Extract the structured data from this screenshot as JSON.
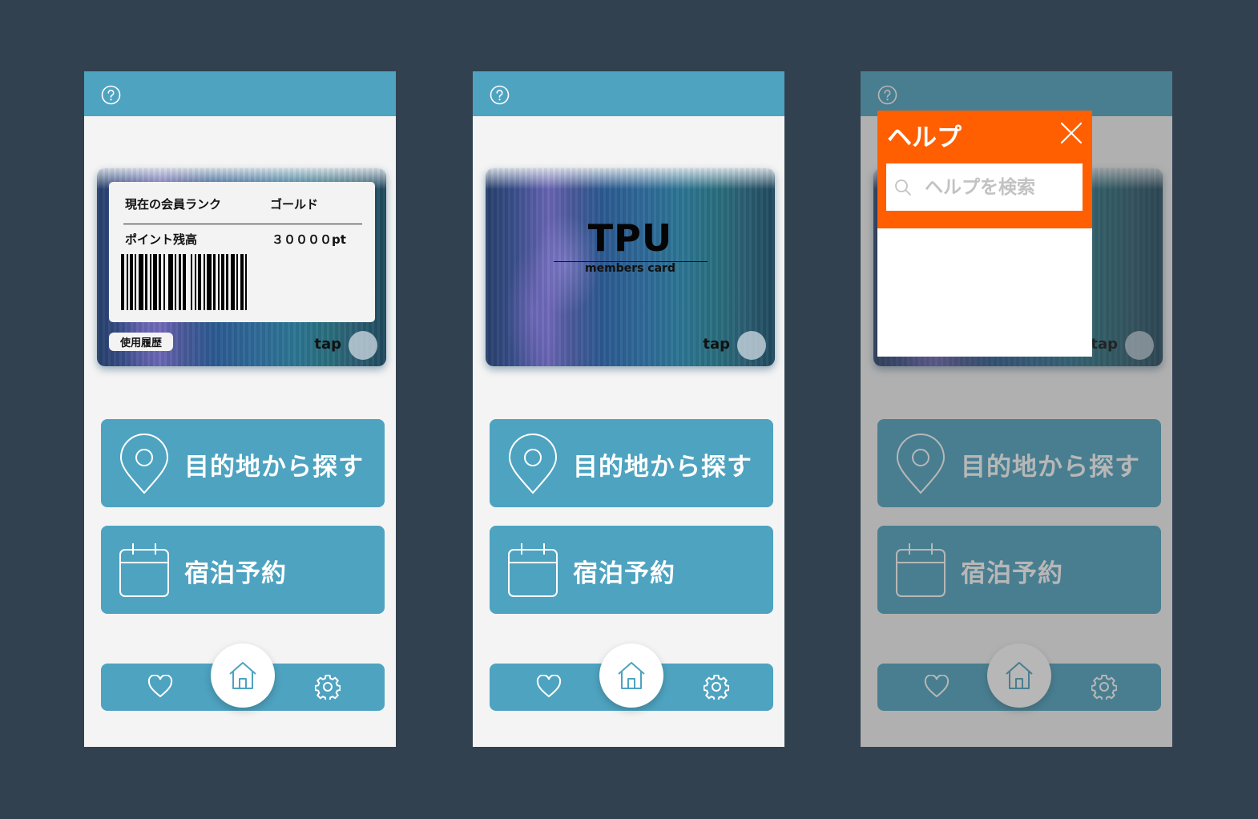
{
  "colors": {
    "background": "#324150",
    "accent": "#4ea3c0",
    "screen_bg": "#f4f4f4",
    "help_header": "#ff5f00"
  },
  "screens": [
    {
      "card": {
        "rank_label": "現在の会員ランク",
        "rank_value": "ゴールド",
        "points_label": "ポイント残高",
        "points_value": "３００００pt",
        "history_label": "使用履歴",
        "tap_label": "tap"
      },
      "menu": {
        "destination_label": "目的地から探す",
        "booking_label": "宿泊予約"
      },
      "icons": {
        "help": "help-circle-icon",
        "destination": "map-pin-icon",
        "booking": "calendar-icon",
        "favorites": "heart-icon",
        "home": "home-icon",
        "settings": "gear-icon"
      }
    },
    {
      "card": {
        "brand": "TPU",
        "subtitle": "members card",
        "tap_label": "tap"
      },
      "menu": {
        "destination_label": "目的地から探す",
        "booking_label": "宿泊予約"
      }
    },
    {
      "card": {
        "tap_label": "tap"
      },
      "menu": {
        "destination_label": "目的地から探す",
        "booking_label": "宿泊予約"
      },
      "help_dialog": {
        "title": "ヘルプ",
        "search_placeholder": "ヘルプを検索",
        "close_icon": "close-icon",
        "search_icon": "search-icon"
      }
    }
  ]
}
